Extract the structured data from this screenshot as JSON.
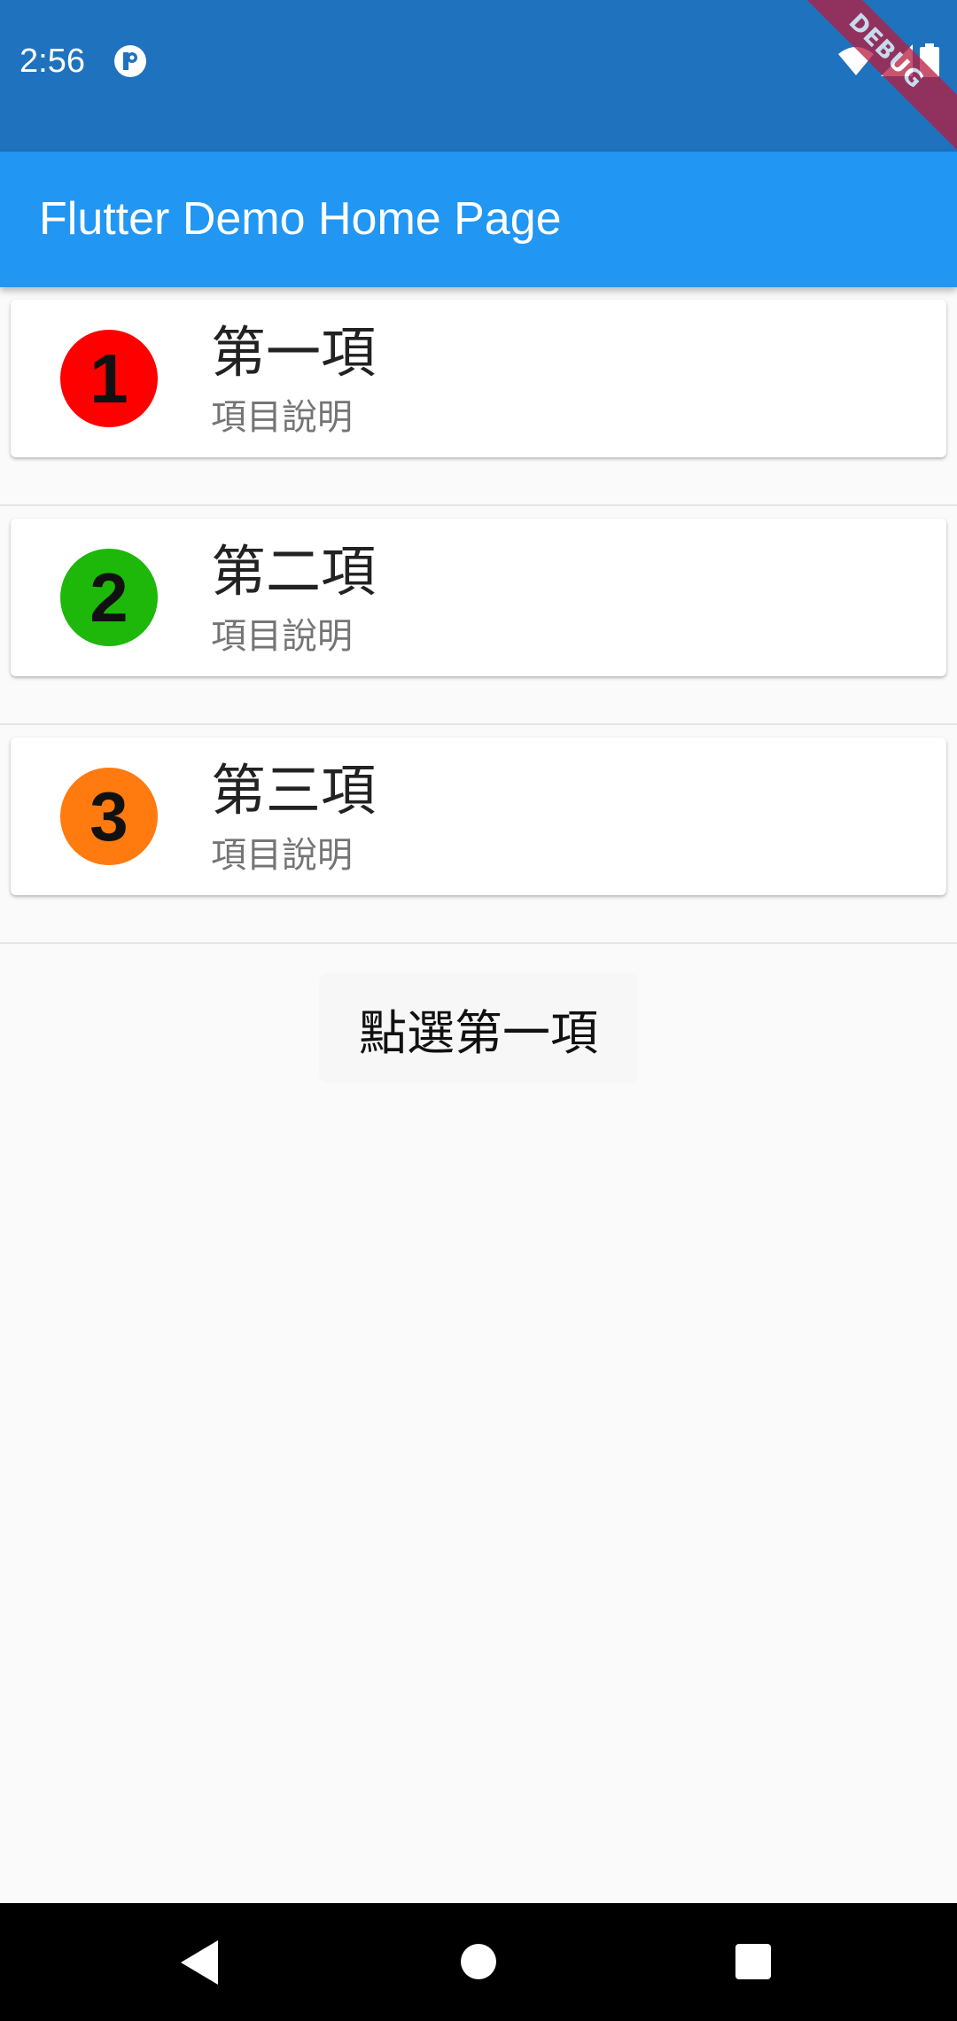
{
  "status_bar": {
    "time": "2:56",
    "icons": {
      "app": "app-notification-icon",
      "wifi": "wifi-icon",
      "signal": "cell-signal-icon",
      "battery": "battery-icon"
    }
  },
  "debug_banner": "DEBUG",
  "app_bar": {
    "title": "Flutter Demo Home Page"
  },
  "list": {
    "items": [
      {
        "number": "1",
        "title": "第一項",
        "subtitle": "項目說明",
        "color": "#ff0000"
      },
      {
        "number": "2",
        "title": "第二項",
        "subtitle": "項目說明",
        "color": "#1db80a"
      },
      {
        "number": "3",
        "title": "第三項",
        "subtitle": "項目說明",
        "color": "#ff7a0f"
      }
    ]
  },
  "selection_text": "點選第一項",
  "nav_bar": {
    "back": "back-icon",
    "home": "home-icon",
    "recents": "recents-icon"
  }
}
